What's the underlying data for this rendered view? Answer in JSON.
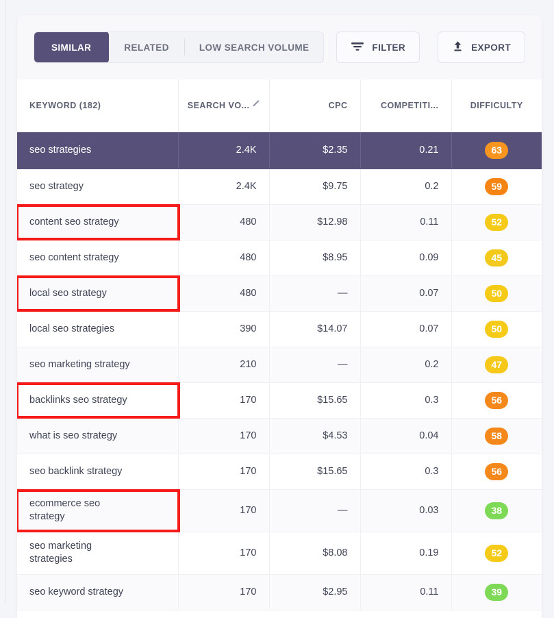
{
  "toolbar": {
    "tabs": [
      {
        "label": "SIMILAR",
        "active": true
      },
      {
        "label": "RELATED",
        "active": false
      },
      {
        "label": "LOW SEARCH VOLUME",
        "active": false
      }
    ],
    "filter_label": "FILTER",
    "export_label": "EXPORT",
    "filter_icon": "filter-icon",
    "export_icon": "upload-arrow-icon"
  },
  "table": {
    "columns": [
      {
        "key": "keyword",
        "label": "KEYWORD  (182)",
        "align": "left"
      },
      {
        "key": "volume",
        "label": "SEARCH VO...",
        "align": "right",
        "sort_icon": "chevron-down-icon",
        "sorted": true
      },
      {
        "key": "cpc",
        "label": "CPC",
        "align": "right"
      },
      {
        "key": "competition",
        "label": "COMPETITI...",
        "align": "right"
      },
      {
        "key": "difficulty",
        "label": "DIFFICULTY",
        "align": "center"
      }
    ],
    "keyword_count": "182",
    "rows": [
      {
        "keyword": "seo strategies",
        "volume": "2.4K",
        "cpc": "$2.35",
        "competition": "0.21",
        "difficulty": "63",
        "difficulty_color": "#f79520",
        "selected": true,
        "highlighted": false
      },
      {
        "keyword": "seo strategy",
        "volume": "2.4K",
        "cpc": "$9.75",
        "competition": "0.2",
        "difficulty": "59",
        "difficulty_color": "#f68412",
        "selected": false,
        "highlighted": false
      },
      {
        "keyword": "content seo strategy",
        "volume": "480",
        "cpc": "$12.98",
        "competition": "0.11",
        "difficulty": "52",
        "difficulty_color": "#f5cb18",
        "selected": false,
        "highlighted": true
      },
      {
        "keyword": "seo content strategy",
        "volume": "480",
        "cpc": "$8.95",
        "competition": "0.09",
        "difficulty": "45",
        "difficulty_color": "#f3ca1c",
        "selected": false,
        "highlighted": false
      },
      {
        "keyword": "local seo strategy",
        "volume": "480",
        "cpc": "—",
        "competition": "0.07",
        "difficulty": "50",
        "difficulty_color": "#f5cb18",
        "selected": false,
        "highlighted": true
      },
      {
        "keyword": "local seo strategies",
        "volume": "390",
        "cpc": "$14.07",
        "competition": "0.07",
        "difficulty": "50",
        "difficulty_color": "#f5cb18",
        "selected": false,
        "highlighted": false
      },
      {
        "keyword": "seo marketing strategy",
        "volume": "210",
        "cpc": "—",
        "competition": "0.2",
        "difficulty": "47",
        "difficulty_color": "#f5c81a",
        "selected": false,
        "highlighted": false
      },
      {
        "keyword": "backlinks seo strategy",
        "volume": "170",
        "cpc": "$15.65",
        "competition": "0.3",
        "difficulty": "56",
        "difficulty_color": "#f5881b",
        "selected": false,
        "highlighted": true
      },
      {
        "keyword": "what is seo strategy",
        "volume": "170",
        "cpc": "$4.53",
        "competition": "0.04",
        "difficulty": "58",
        "difficulty_color": "#f5881b",
        "selected": false,
        "highlighted": false
      },
      {
        "keyword": "seo backlink strategy",
        "volume": "170",
        "cpc": "$15.65",
        "competition": "0.3",
        "difficulty": "56",
        "difficulty_color": "#f5881b",
        "selected": false,
        "highlighted": false
      },
      {
        "keyword": "ecommerce seo strategy",
        "volume": "170",
        "cpc": "—",
        "competition": "0.03",
        "difficulty": "38",
        "difficulty_color": "#7ed957",
        "selected": false,
        "highlighted": true,
        "wrap": true
      },
      {
        "keyword": "seo marketing strategies",
        "volume": "170",
        "cpc": "$8.08",
        "competition": "0.19",
        "difficulty": "52",
        "difficulty_color": "#f5cb18",
        "selected": false,
        "highlighted": false,
        "wrap": true
      },
      {
        "keyword": "seo keyword strategy",
        "volume": "170",
        "cpc": "$2.95",
        "competition": "0.11",
        "difficulty": "39",
        "difficulty_color": "#7ed957",
        "selected": false,
        "highlighted": false
      }
    ]
  },
  "annotations": {
    "color": "#f61b1b",
    "boxes": [
      {
        "label": "annotation-content-seo-strategy",
        "row_index": 2
      },
      {
        "label": "annotation-local-seo-strategy",
        "row_index": 4
      },
      {
        "label": "annotation-backlinks-seo-strategy",
        "row_index": 7
      },
      {
        "label": "annotation-ecommerce-seo-strategy",
        "row_index": 10
      }
    ]
  },
  "theme": {
    "accent": "#575179",
    "page_bg": "#f4f5f8",
    "card_bg": "#ffffff"
  }
}
